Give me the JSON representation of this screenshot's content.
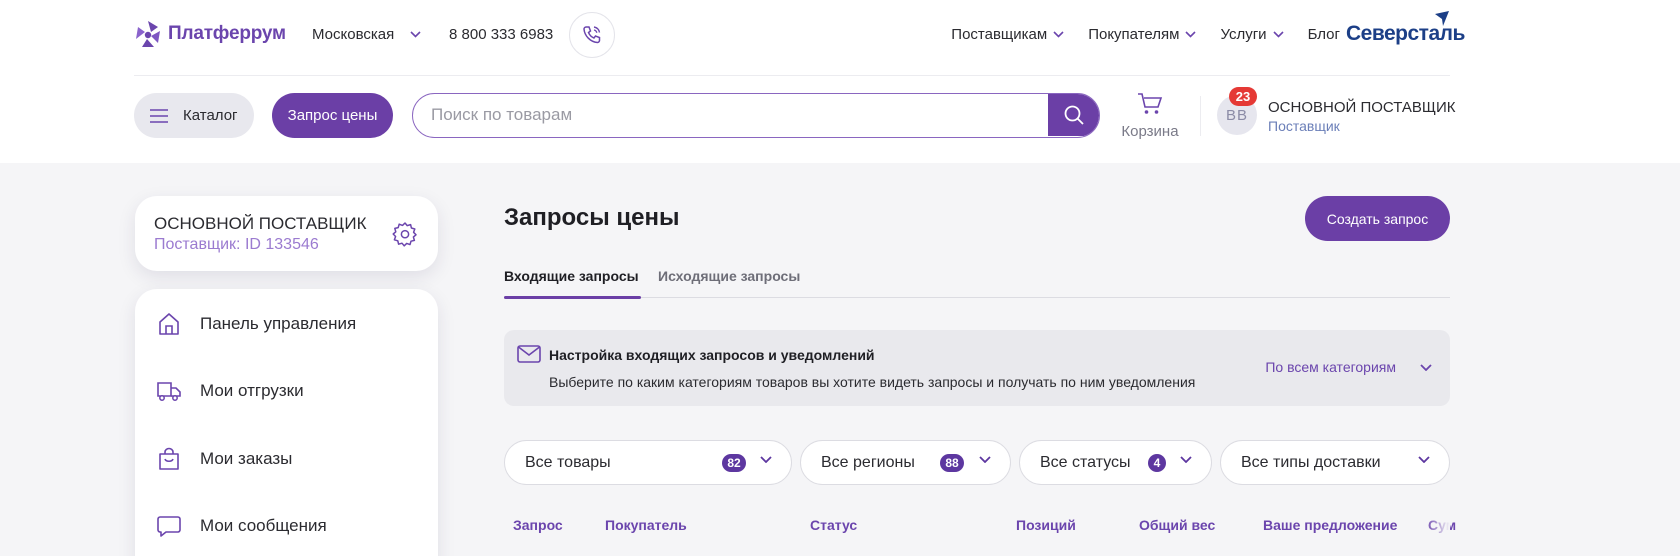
{
  "header": {
    "logo_text": "Платферрум",
    "region": "Московская",
    "phone": "8 800 333 6983",
    "nav": [
      "Поставщикам",
      "Покупателям",
      "Услуги",
      "Блог"
    ],
    "brand": "Северсталь",
    "catalog_label": "Каталог",
    "price_request_label": "Запрос цены",
    "search_placeholder": "Поиск по товарам",
    "cart_label": "Корзина",
    "notifications_count": "23",
    "avatar_initials": "ВВ",
    "user_name": "ОСНОВНОЙ ПОСТАВЩИК",
    "user_role": "Поставщик",
    "accent_color": "#6b3fa6"
  },
  "sidebar": {
    "profile_name": "ОСНОВНОЙ ПОСТАВЩИК",
    "profile_id": "Поставщик: ID 133546",
    "items": [
      {
        "label": "Панель управления",
        "icon": "home-icon"
      },
      {
        "label": "Мои отгрузки",
        "icon": "truck-icon"
      },
      {
        "label": "Мои заказы",
        "icon": "bag-icon"
      },
      {
        "label": "Мои сообщения",
        "icon": "chat-icon"
      }
    ]
  },
  "main": {
    "title": "Запросы цены",
    "create_button": "Создать запрос",
    "tabs": [
      {
        "label": "Входящие запросы",
        "active": true
      },
      {
        "label": "Исходящие запросы",
        "active": false
      }
    ],
    "notice": {
      "title": "Настройка входящих запросов и уведомлений",
      "text": "Выберите по каким категориям товаров вы хотите видеть запросы и получать по ним уведомления",
      "select_value": "По всем категориям"
    },
    "filters": [
      {
        "label": "Все товары",
        "count": "82"
      },
      {
        "label": "Все регионы",
        "count": "88"
      },
      {
        "label": "Все статусы",
        "count": "4"
      },
      {
        "label": "Все типы доставки",
        "count": null
      }
    ],
    "table_headers": [
      "Запрос",
      "Покупатель",
      "Статус",
      "Позиций",
      "Общий вес",
      "Ваше предложение",
      "Сум"
    ]
  }
}
